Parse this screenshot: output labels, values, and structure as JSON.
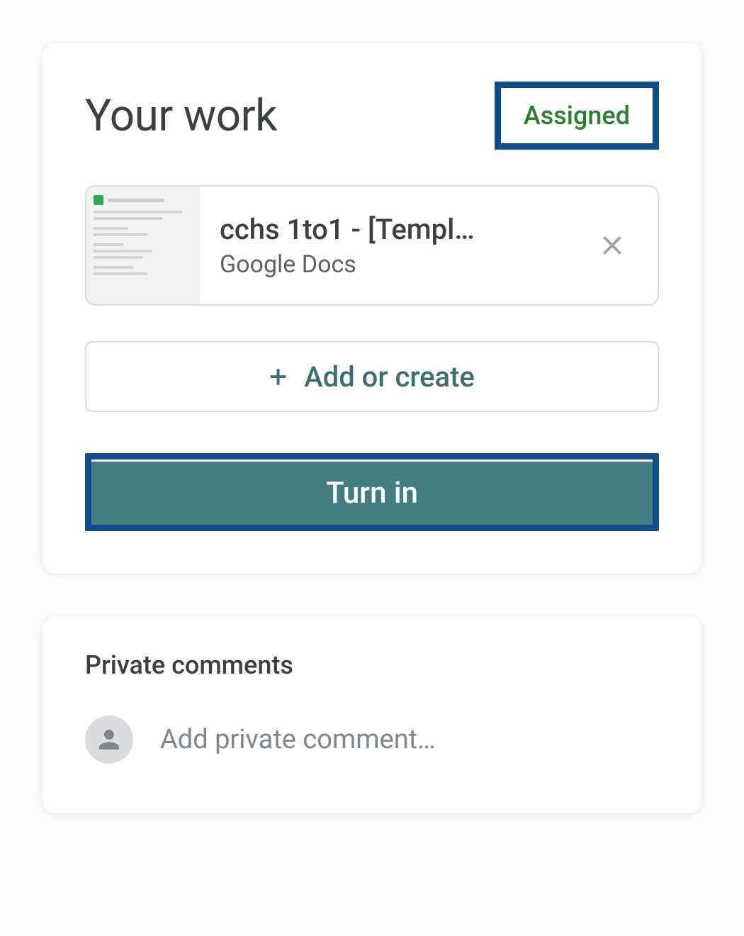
{
  "work": {
    "title": "Your work",
    "status": "Assigned",
    "attachment": {
      "title": "cchs 1to1 - [Templ…",
      "subtitle": "Google Docs"
    },
    "add_create_label": "Add or create",
    "turn_in_label": "Turn in"
  },
  "comments": {
    "title": "Private comments",
    "placeholder": "Add private comment…"
  }
}
